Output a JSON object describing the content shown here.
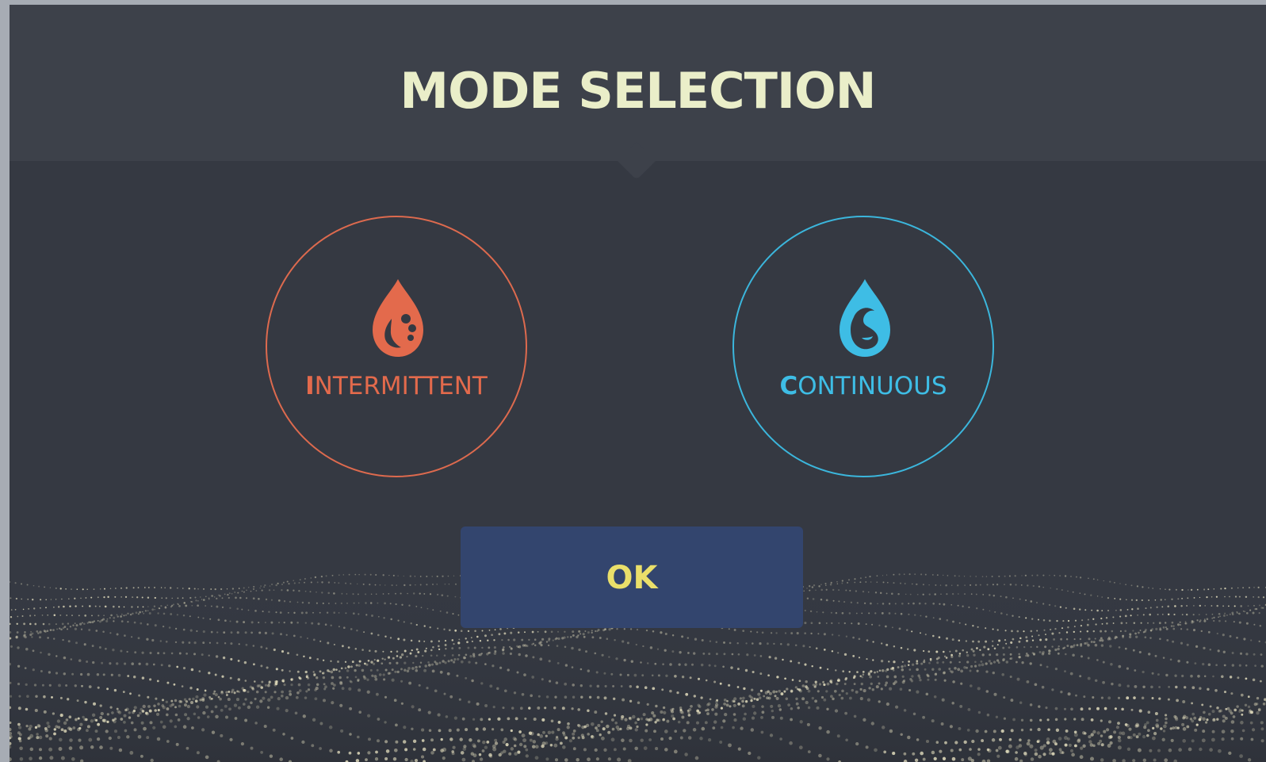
{
  "dialog": {
    "title": "MODE SELECTION"
  },
  "modes": [
    {
      "initial": "I",
      "rest": "NTERMITTENT",
      "icon": "intermittent-drop-icon",
      "color": "#e36a4c"
    },
    {
      "initial": "C",
      "rest": "ONTINUOUS",
      "icon": "continuous-drop-icon",
      "color": "#3ebde5"
    }
  ],
  "actions": {
    "ok_label": "OK"
  },
  "colors": {
    "background": "#353942",
    "header": "#3d414a",
    "title": "#eaeec9",
    "ok_button": "#33456e",
    "ok_text": "#eadf6a"
  }
}
